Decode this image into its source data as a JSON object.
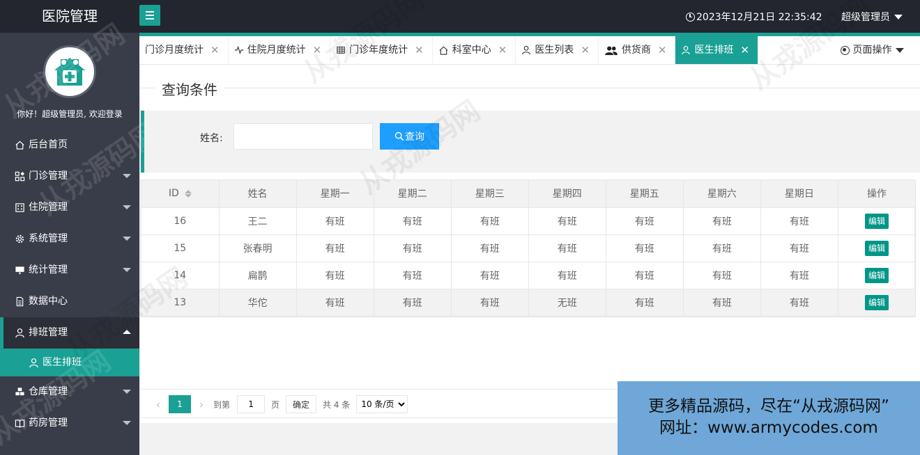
{
  "header": {
    "brand": "医院管理",
    "datetime": "2023年12月21日 22:35:42",
    "user": "超级管理员"
  },
  "sidebar": {
    "welcome": "你好！超级管理员, 欢迎登录",
    "items": [
      {
        "label": "后台首页",
        "icon": "home-icon"
      },
      {
        "label": "门诊管理",
        "icon": "apps-icon"
      },
      {
        "label": "住院管理",
        "icon": "building-icon"
      },
      {
        "label": "系统管理",
        "icon": "gear-icon"
      },
      {
        "label": "统计管理",
        "icon": "chart-icon"
      },
      {
        "label": "数据中心",
        "icon": "document-icon"
      },
      {
        "label": "排班管理",
        "icon": "user-icon"
      },
      {
        "label": "医生排班",
        "icon": "user-icon"
      },
      {
        "label": "仓库管理",
        "icon": "warehouse-icon"
      },
      {
        "label": "药房管理",
        "icon": "book-icon"
      }
    ]
  },
  "tabs": [
    {
      "label": "门诊月度统计",
      "icon": ""
    },
    {
      "label": "住院月度统计",
      "icon": "pulse-icon"
    },
    {
      "label": "门诊年度统计",
      "icon": "table-icon"
    },
    {
      "label": "科室中心",
      "icon": "home-icon"
    },
    {
      "label": "医生列表",
      "icon": "user-icon"
    },
    {
      "label": "供货商",
      "icon": "users-icon"
    },
    {
      "label": "医生排班",
      "icon": "user-icon"
    }
  ],
  "page_ops": "页面操作",
  "query": {
    "legend": "查询条件",
    "name_label": "姓名:",
    "name_value": "",
    "search_label": "查询"
  },
  "table": {
    "columns": [
      "ID",
      "姓名",
      "星期一",
      "星期二",
      "星期三",
      "星期四",
      "星期五",
      "星期六",
      "星期日",
      "操作"
    ],
    "rows": [
      {
        "id": "16",
        "name": "王二",
        "days": [
          "有班",
          "有班",
          "有班",
          "有班",
          "有班",
          "有班",
          "有班"
        ],
        "action": "编辑"
      },
      {
        "id": "15",
        "name": "张春明",
        "days": [
          "有班",
          "有班",
          "有班",
          "有班",
          "有班",
          "有班",
          "有班"
        ],
        "action": "编辑"
      },
      {
        "id": "14",
        "name": "扁鹊",
        "days": [
          "有班",
          "有班",
          "有班",
          "有班",
          "有班",
          "有班",
          "有班"
        ],
        "action": "编辑"
      },
      {
        "id": "13",
        "name": "华佗",
        "days": [
          "有班",
          "有班",
          "有班",
          "无班",
          "有班",
          "有班",
          "有班"
        ],
        "action": "编辑"
      }
    ]
  },
  "pager": {
    "prev": "‹",
    "current": "1",
    "next": "›",
    "goto_label": "到第",
    "goto_value": "1",
    "page_label": "页",
    "confirm": "确定",
    "total": "共 4 条",
    "per_page": "10 条/页"
  },
  "ad": {
    "line1": "更多精品源码，尽在“从戎源码网”",
    "line2": "网址：www.armycodes.com"
  },
  "watermark": "从戎源码网",
  "colors": {
    "header": "#23262e",
    "sidebar": "#393d49",
    "accent": "#1aa094",
    "search_button": "#1e9fff",
    "edit_button": "#009688"
  }
}
